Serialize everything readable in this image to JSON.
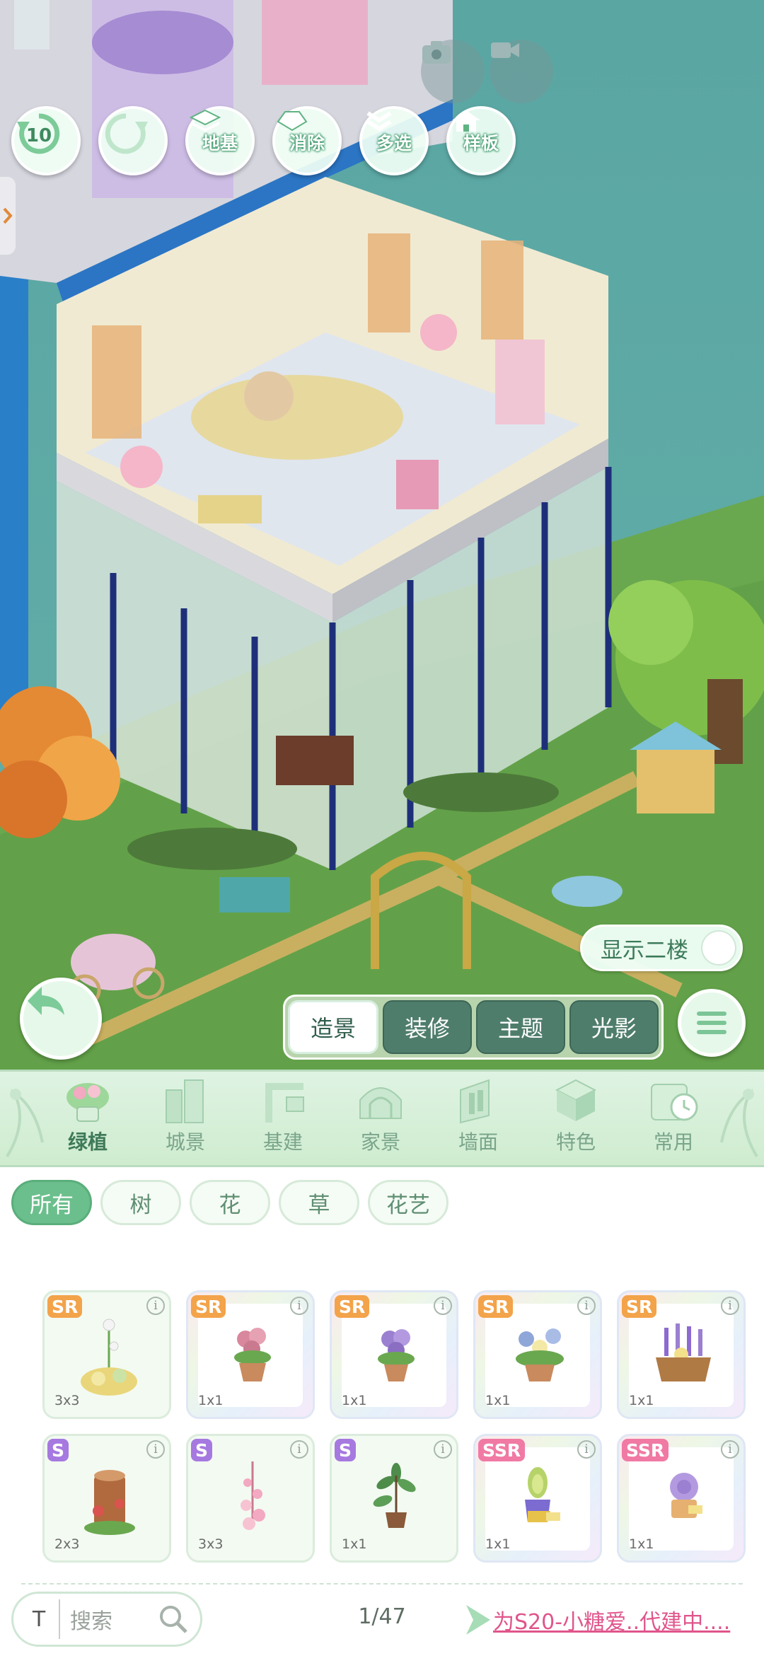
{
  "toolbar": {
    "undo_count": "10",
    "buttons": [
      {
        "label": "地基"
      },
      {
        "label": "消除"
      },
      {
        "label": "多选"
      },
      {
        "label": "样板"
      }
    ]
  },
  "floor_toggle": {
    "label": "显示二楼",
    "enabled": false
  },
  "mode_tabs": [
    {
      "label": "造景",
      "active": true
    },
    {
      "label": "装修",
      "active": false
    },
    {
      "label": "主题",
      "active": false
    },
    {
      "label": "光影",
      "active": false
    }
  ],
  "categories": [
    {
      "label": "绿植",
      "icon": "potted-plant-icon",
      "active": true
    },
    {
      "label": "城景",
      "icon": "city-icon",
      "active": false
    },
    {
      "label": "基建",
      "icon": "crane-icon",
      "active": false
    },
    {
      "label": "家景",
      "icon": "home-dome-icon",
      "active": false
    },
    {
      "label": "墙面",
      "icon": "wall-icon",
      "active": false
    },
    {
      "label": "特色",
      "icon": "cube-icon",
      "active": false
    },
    {
      "label": "常用",
      "icon": "calendar-clock-icon",
      "active": false
    }
  ],
  "filters": [
    {
      "label": "所有",
      "active": true
    },
    {
      "label": "树",
      "active": false
    },
    {
      "label": "花",
      "active": false
    },
    {
      "label": "草",
      "active": false
    },
    {
      "label": "花艺",
      "active": false
    }
  ],
  "items": [
    {
      "rarity": "SR",
      "size": "3x3",
      "icon": "flower-arrangement-icon"
    },
    {
      "rarity": "SR",
      "size": "1x1",
      "icon": "pink-flower-pot-icon"
    },
    {
      "rarity": "SR",
      "size": "1x1",
      "icon": "purple-flower-pot-icon"
    },
    {
      "rarity": "SR",
      "size": "1x1",
      "icon": "blue-flower-pot-icon"
    },
    {
      "rarity": "SR",
      "size": "1x1",
      "icon": "lavender-basket-icon"
    },
    {
      "rarity": "S",
      "size": "2x3",
      "icon": "tree-stump-icon"
    },
    {
      "rarity": "S",
      "size": "3x3",
      "icon": "pink-blossom-stalk-icon"
    },
    {
      "rarity": "S",
      "size": "1x1",
      "icon": "leafy-plant-pot-icon"
    },
    {
      "rarity": "SSR",
      "size": "1x1",
      "icon": "succulent-icon"
    },
    {
      "rarity": "SSR",
      "size": "1x1",
      "icon": "purple-rose-cake-icon"
    }
  ],
  "search": {
    "placeholder": "搜索",
    "toggle_label": "T"
  },
  "pagination": {
    "text": "1/47"
  },
  "ticker": {
    "text": "为S20-小糖爱..代建中...."
  },
  "colors": {
    "accent": "#6bbf8c",
    "ticker": "#e0558b",
    "rarity_SR": "#f3a34a",
    "rarity_S": "#a679e0",
    "rarity_SSR": "#f07aa4"
  }
}
